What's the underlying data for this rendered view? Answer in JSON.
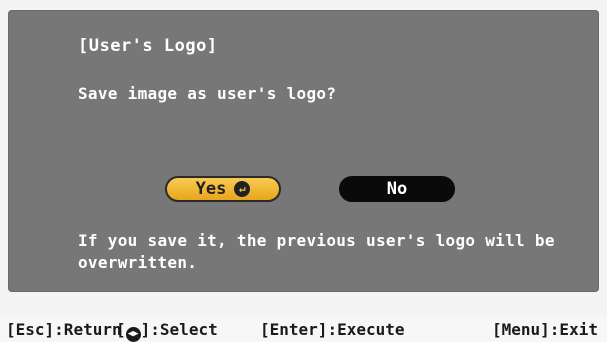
{
  "dialog": {
    "title": "[User's Logo]",
    "question": "Save image as user's logo?",
    "yes_label": "Yes",
    "no_label": "No",
    "warning": "If you save it, the previous user's logo will be overwritten.",
    "selected_button": "Yes",
    "colors": {
      "panel": "#777777",
      "selected": "#f0b43a",
      "unselected": "#0a0a0a"
    }
  },
  "statusbar": {
    "esc_key": "[Esc]",
    "esc_action": ":Return",
    "select_open": "[",
    "select_close": "]",
    "select_action": ":Select",
    "enter_key": "[Enter]",
    "enter_action": ":Execute",
    "menu_key": "[Menu]",
    "menu_action": ":Exit"
  },
  "icons": {
    "enter": "enter-icon",
    "arrows": "left-right-arrows-icon"
  }
}
